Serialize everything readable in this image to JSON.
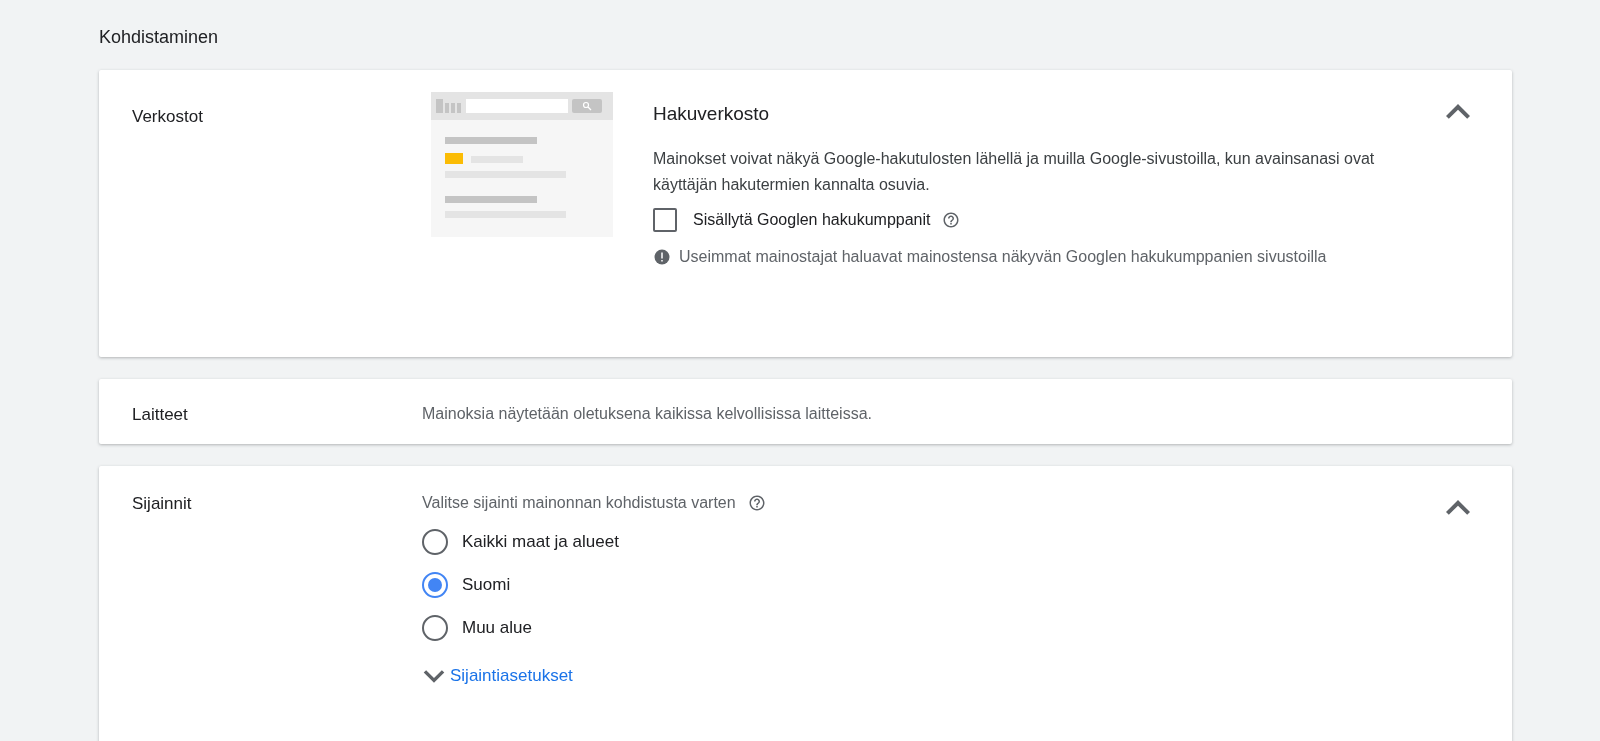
{
  "heading": "Kohdistaminen",
  "sections": [
    {
      "kind": "networks",
      "label": "Verkostot",
      "expanded": true,
      "title": "Hakuverkosto",
      "description": "Mainokset voivat näkyä Google-hakutulosten lähellä ja muilla Google-sivustoilla, kun avainsanasi ovat käyttäjän hakutermien kannalta osuvia.",
      "checkbox": {
        "label": "Sisällytä Googlen hakukumppanit",
        "checked": false
      },
      "notice": "Useimmat mainostajat haluavat mainostensa näkyvän Googlen hakukumppanien sivustoilla"
    },
    {
      "kind": "summary",
      "label": "Laitteet",
      "text": "Mainoksia näytetään oletuksena kaikissa kelvollisissa laitteissa."
    },
    {
      "kind": "locations",
      "label": "Sijainnit",
      "expanded": true,
      "prompt": "Valitse sijainti mainonnan kohdistusta varten",
      "options": [
        {
          "label": "Kaikki maat ja alueet",
          "selected": false
        },
        {
          "label": "Suomi",
          "selected": true
        },
        {
          "label": "Muu alue",
          "selected": false
        }
      ],
      "link": {
        "label": "Sijaintiasetukset",
        "expanded": false
      }
    }
  ]
}
